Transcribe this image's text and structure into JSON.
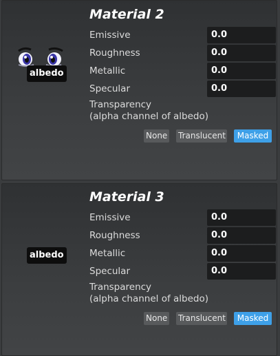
{
  "materials": [
    {
      "title": "Material 2",
      "thumbnail_label": "albedo",
      "thumbnail_icon": "anime-eyes-texture",
      "properties": [
        {
          "label": "Emissive",
          "value": "0.0"
        },
        {
          "label": "Roughness",
          "value": "0.0"
        },
        {
          "label": "Metallic",
          "value": "0.0"
        },
        {
          "label": "Specular",
          "value": "0.0"
        }
      ],
      "transparency_label_line1": "Transparency",
      "transparency_label_line2": "(alpha channel of albedo)",
      "transparency_options": [
        "None",
        "Translucent",
        "Masked"
      ],
      "transparency_selected": "Masked"
    },
    {
      "title": "Material 3",
      "thumbnail_label": "albedo",
      "thumbnail_icon": "small-dot-texture",
      "properties": [
        {
          "label": "Emissive",
          "value": "0.0"
        },
        {
          "label": "Roughness",
          "value": "0.0"
        },
        {
          "label": "Metallic",
          "value": "0.0"
        },
        {
          "label": "Specular",
          "value": "0.0"
        }
      ],
      "transparency_label_line1": "Transparency",
      "transparency_label_line2": "(alpha channel of albedo)",
      "transparency_options": [
        "None",
        "Translucent",
        "Masked"
      ],
      "transparency_selected": "Masked"
    }
  ],
  "colors": {
    "selected_option": "#3ea0e8",
    "value_field_bg": "#1c1d1e",
    "panel_bg": "#3a3c3e"
  }
}
